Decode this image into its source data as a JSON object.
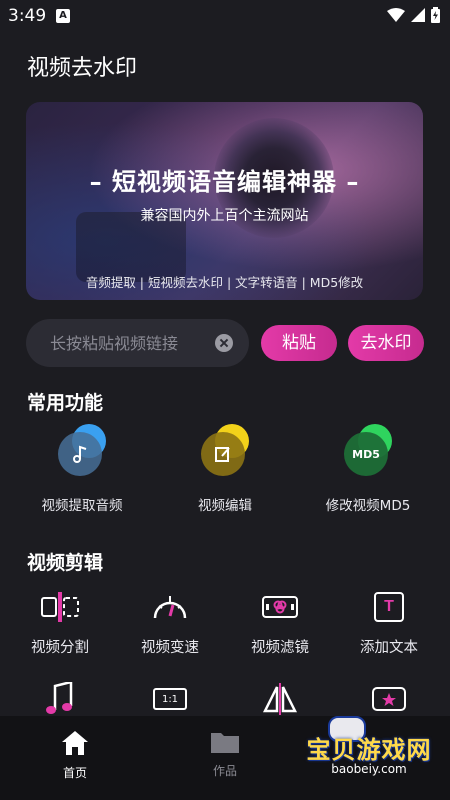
{
  "status_bar": {
    "time": "3:49",
    "notification_badge": "A"
  },
  "app": {
    "title": "视频去水印"
  },
  "banner": {
    "title": "– 短视频语音编辑神器 –",
    "subtitle": "兼容国内外上百个主流网站",
    "tags": "音频提取 | 短视频去水印 | 文字转语音 | MD5修改"
  },
  "link_input": {
    "placeholder": "长按粘贴视频链接",
    "value": ""
  },
  "buttons": {
    "paste": "粘贴",
    "remove_watermark": "去水印"
  },
  "common_functions": {
    "title": "常用功能",
    "items": [
      {
        "label": "视频提取音频",
        "icon": "music-note-icon",
        "color": "#4aa8e8"
      },
      {
        "label": "视频编辑",
        "icon": "edit-icon",
        "color": "#e8c21a"
      },
      {
        "label": "修改视频MD5",
        "icon": "md5-icon",
        "color": "#2fc45a",
        "icon_text": "MD5"
      }
    ]
  },
  "video_editing": {
    "title": "视频剪辑",
    "items": [
      {
        "label": "视频分割",
        "icon": "split-icon"
      },
      {
        "label": "视频变速",
        "icon": "speed-gauge-icon"
      },
      {
        "label": "视频滤镜",
        "icon": "filter-icon"
      },
      {
        "label": "添加文本",
        "icon": "text-icon",
        "icon_text": "T"
      }
    ],
    "row2_icons": [
      {
        "icon": "music-icon"
      },
      {
        "icon": "ratio-icon",
        "icon_text": "1:1"
      },
      {
        "icon": "mirror-icon"
      },
      {
        "icon": "sticker-icon"
      }
    ]
  },
  "bottom_nav": {
    "items": [
      {
        "label": "首页",
        "icon": "home-icon",
        "active": true
      },
      {
        "label": "作品",
        "icon": "folder-icon",
        "active": false
      }
    ]
  },
  "watermark": {
    "text": "宝贝游戏网",
    "url": "baobeiy.com"
  },
  "colors": {
    "accent": "#e33aa8",
    "background": "#1c1c21",
    "nav_bg": "#121215"
  }
}
